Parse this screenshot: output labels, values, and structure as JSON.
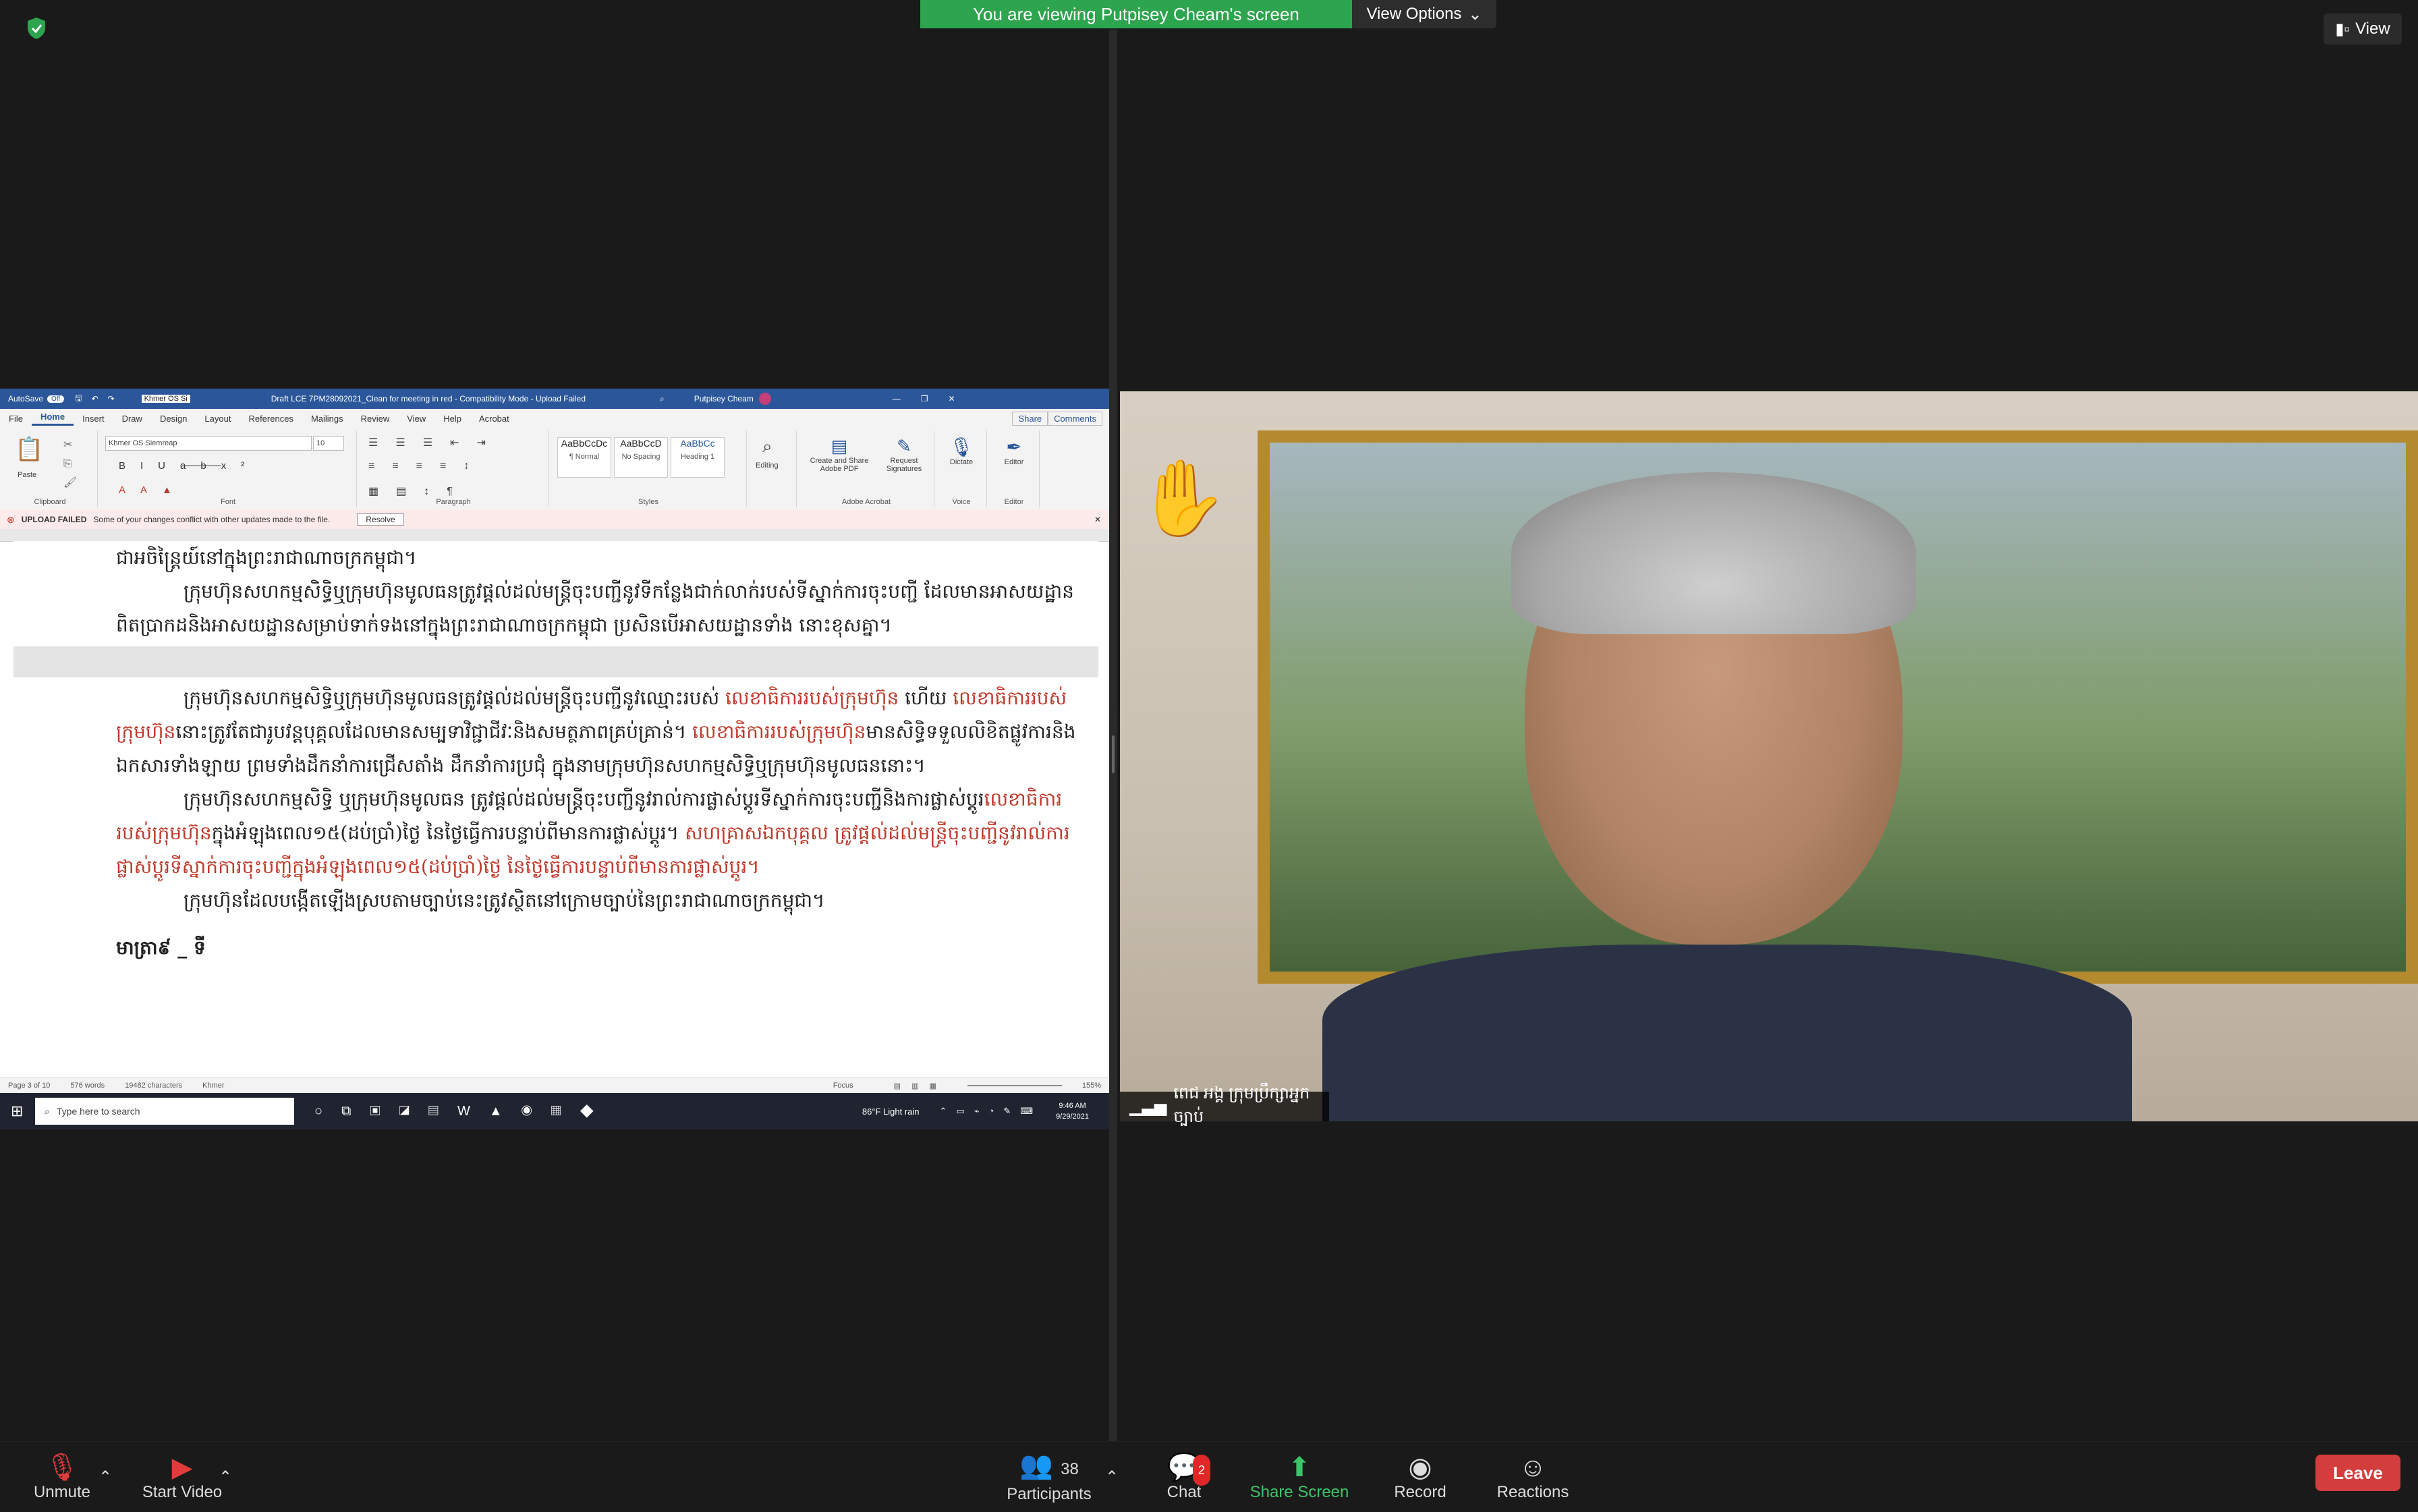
{
  "banner": {
    "text": "You are viewing Putpisey Cheam's screen",
    "view_options": "View Options"
  },
  "view_button": "View",
  "word": {
    "autosave": "AutoSave",
    "autosave_state": "Off",
    "font_box": "Khmer OS Si",
    "title": "Draft LCE 7PM28092021_Clean for meeting in red  -  Compatibility Mode  -  Upload Failed",
    "user": "Putpisey Cheam",
    "tabs": [
      "File",
      "Home",
      "Insert",
      "Draw",
      "Design",
      "Layout",
      "References",
      "Mailings",
      "Review",
      "View",
      "Help",
      "Acrobat"
    ],
    "share": "Share",
    "comments": "Comments",
    "ribbon": {
      "clipboard": "Clipboard",
      "paste": "Paste",
      "font": "Font",
      "font_name": "Khmer OS Siemreap",
      "font_size": "10",
      "paragraph": "Paragraph",
      "styles": "Styles",
      "style_items": [
        {
          "sample": "AaBbCcDc",
          "name": "¶ Normal"
        },
        {
          "sample": "AaBbCcD",
          "name": "No Spacing"
        },
        {
          "sample": "AaBbCc",
          "name": "Heading 1"
        }
      ],
      "editing": "Editing",
      "create_share": "Create and Share Adobe PDF",
      "request_sig": "Request Signatures",
      "adobe_acrobat": "Adobe Acrobat",
      "dictate": "Dictate",
      "voice": "Voice",
      "editor": "Editor",
      "editor_grp": "Editor"
    },
    "message": {
      "label": "UPLOAD FAILED",
      "text": "Some of your changes conflict with other updates made to the file.",
      "resolve": "Resolve"
    },
    "doc": {
      "p0": "ជាអចិន្ត្រៃយ៍នៅក្នុងព្រះរាជាណាចក្រកម្ពុជា។",
      "p1": "ក្រុមហ៊ុនសហកម្មសិទ្ធិឬក្រុមហ៊ុនមូលធនត្រូវផ្តល់ដល់មន្រ្តីចុះបញ្ជីនូវទីកន្លែងជាក់លាក់របស់ទីស្នាក់ការចុះបញ្ជី ដែលមានអាសយដ្ឋានពិតប្រាកដនិងអាសយដ្ឋានសម្រាប់ទាក់ទងនៅក្នុងព្រះរាជាណាចក្រកម្ពុជា ប្រសិនបើអាសយដ្ឋានទាំង នោះខុសគ្នា។",
      "p2a": "ក្រុមហ៊ុនសហកម្មសិទ្ធិឬក្រុមហ៊ុនមូលធនត្រូវផ្តល់ដល់មន្រ្តីចុះបញ្ជីនូវឈ្មោះរបស់ ",
      "p2b": "លេខាធិការរបស់ក្រុមហ៊ុន",
      "p2c": " ហើយ ",
      "p2d": "លេខាធិការរបស់ក្រុមហ៊ុន",
      "p2e": "នោះត្រូវតែជារូបវន្តបុគ្គលដែលមានសម្បទាវិជ្ជាជីវៈនិងសមត្ថភាពគ្រប់គ្រាន់។ ",
      "p2f": "លេខាធិការរបស់ក្រុមហ៊ុន",
      "p2g": "មានសិទ្ធិទទួលលិខិតផ្លូវការនិងឯកសារទាំងឡាយ ព្រមទាំងដឹកនាំការជ្រើសតាំង ដឹកនាំការប្រជុំ ក្នុងនាមក្រុមហ៊ុនសហកម្មសិទ្ធិឬក្រុមហ៊ុនមូលធននោះ។",
      "p3a": "ក្រុមហ៊ុនសហកម្មសិទ្ធិ ឬក្រុមហ៊ុនមូលធន ត្រូវផ្តល់ដល់មន្រ្តីចុះបញ្ជីនូវរាល់ការផ្លាស់ប្តូរទីស្នាក់ការចុះបញ្ជីនិងការផ្លាស់ប្តូរ",
      "p3b": "លេខាធិការរបស់ក្រុមហ៊ុន",
      "p3c": "ក្នុងអំឡុងពេល១៥(ដប់ប្រាំ)ថ្ងៃ នៃថ្ងៃធ្វើការបន្ទាប់ពីមានការផ្លាស់ប្តូរ។ ",
      "p3d": "សហគ្រាសឯកបុគ្គល ត្រូវផ្តល់ដល់មន្រ្តីចុះបញ្ជីនូវរាល់ការផ្លាស់ប្តូរទីស្នាក់ការចុះបញ្ជីក្នុងអំឡុងពេល១៥(ដប់ប្រាំ)ថ្ងៃ នៃថ្ងៃធ្វើការបន្ទាប់ពីមានការផ្លាស់ប្តូរ។",
      "p4": "ក្រុមហ៊ុនដែលបង្កើតឡើងស្របតាមច្បាប់នេះត្រូវស្ថិតនៅក្រោមច្បាប់នៃព្រះរាជាណាចក្រកម្ពុជា។",
      "heading": "មាត្រា៩ _ ទី"
    },
    "status": {
      "page": "Page 3 of 10",
      "words": "576 words",
      "chars": "19482 characters",
      "lang": "Khmer",
      "focus": "Focus",
      "zoom": "155%"
    },
    "taskbar": {
      "search": "Type here to search",
      "weather": "86°F  Light rain",
      "time": "9:46 AM",
      "date": "9/29/2021"
    }
  },
  "video": {
    "name": "ពេជ អង្គ ក្រុមប្រឹក្សាអ្នកច្បាប់"
  },
  "controls": {
    "unmute": "Unmute",
    "start_video": "Start Video",
    "participants": "Participants",
    "participants_count": "38",
    "chat": "Chat",
    "chat_badge": "2",
    "share_screen": "Share Screen",
    "record": "Record",
    "reactions": "Reactions",
    "leave": "Leave"
  }
}
